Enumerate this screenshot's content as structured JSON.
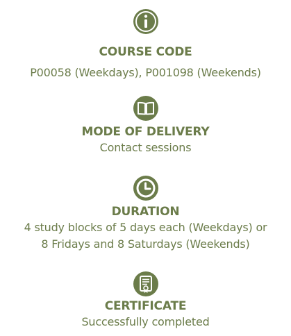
{
  "colors": {
    "accent": "#6b7c4a",
    "heading": "#6b7c4a",
    "text": "#6b7c4a",
    "icon_fill": "#6b7c4a",
    "icon_line": "#ffffff"
  },
  "sections": [
    {
      "icon": "info-icon",
      "heading": "COURSE CODE",
      "value": "P00058 (Weekdays), P001098 (Weekends)"
    },
    {
      "icon": "book-icon",
      "heading": "MODE OF DELIVERY",
      "value": "Contact sessions"
    },
    {
      "icon": "clock-icon",
      "heading": "DURATION",
      "value_line1": "4 study blocks of 5 days each (Weekdays) or",
      "value_line2": "8 Fridays and 8 Saturdays (Weekends)"
    },
    {
      "icon": "certificate-icon",
      "heading": "CERTIFICATE",
      "value": "Successfully completed"
    }
  ]
}
